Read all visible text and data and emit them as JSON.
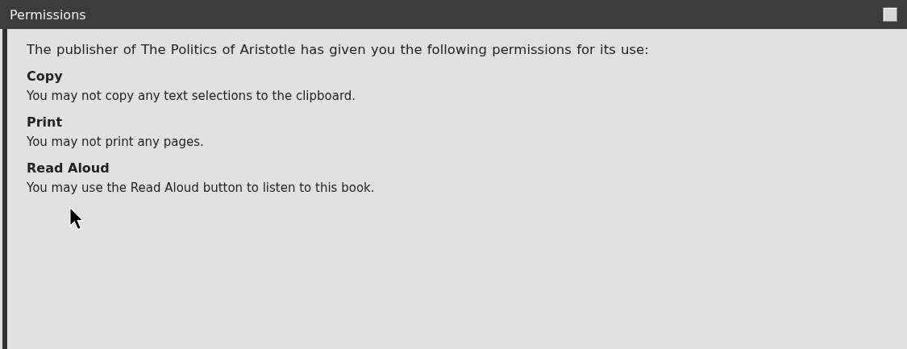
{
  "window": {
    "title": "Permissions"
  },
  "intro": "The publisher of The Politics of Aristotle has given you the following permissions for its use:",
  "permissions": [
    {
      "name": "Copy",
      "description": "You may not copy any text selections to the clipboard."
    },
    {
      "name": "Print",
      "description": "You may not print any pages."
    },
    {
      "name": "Read Aloud",
      "description": "You may use the Read Aloud button to listen to this book."
    }
  ]
}
